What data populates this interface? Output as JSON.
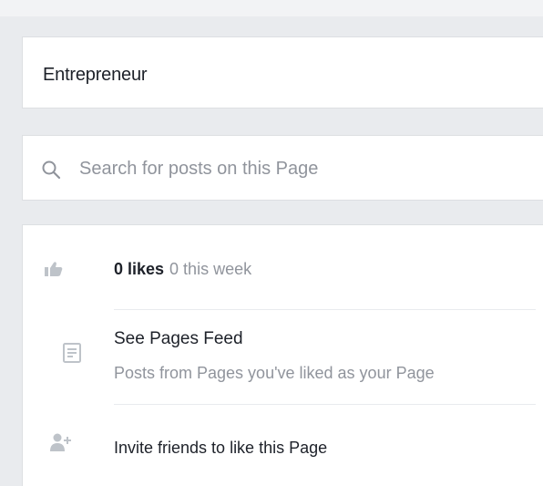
{
  "colors": {
    "page_background": "#e9ebee",
    "card_background": "#ffffff",
    "primary_text": "#1d2129",
    "secondary_text": "#90949c",
    "icon_gray": "#bec3c9"
  },
  "page_info": {
    "category": "Entrepreneur"
  },
  "search": {
    "icon": "search-icon",
    "placeholder": "Search for posts on this Page",
    "value": ""
  },
  "details": {
    "likes": {
      "icon": "thumbs-up-icon",
      "count_label": "0 likes",
      "week_label": "0 this week"
    },
    "pages_feed": {
      "icon": "news-feed-icon",
      "title": "See Pages Feed",
      "subtitle": "Posts from Pages you've liked as your Page"
    },
    "invite": {
      "icon": "invite-friend-icon",
      "label": "Invite friends to like this Page"
    }
  }
}
